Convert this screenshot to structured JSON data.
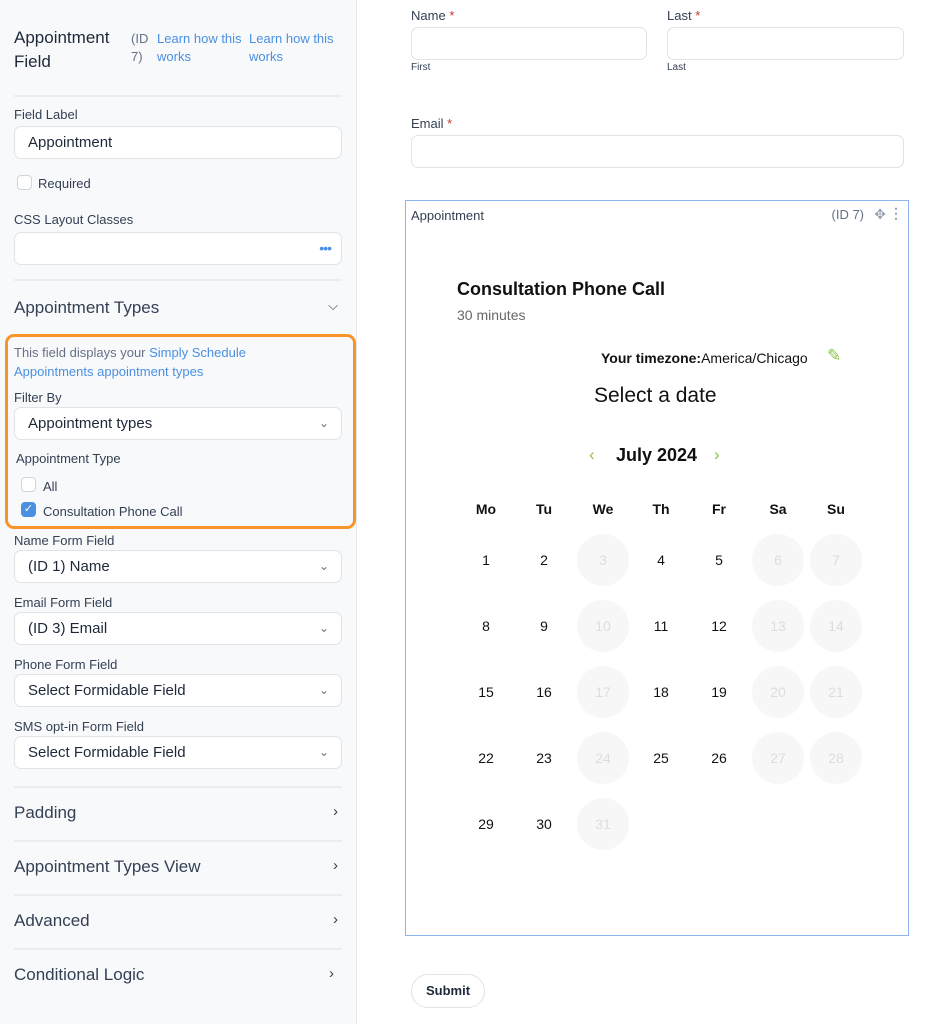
{
  "sidebar": {
    "title": "Appointment Field",
    "field_id": "(ID 7)",
    "learn_links": [
      "Learn how this works",
      "Learn how this works"
    ],
    "field_label": {
      "label": "Field Label",
      "value": "Appointment"
    },
    "required": {
      "label": "Required",
      "checked": false
    },
    "css_classes": {
      "label": "CSS Layout Classes",
      "value": "",
      "more_icon": "ellipsis-icon"
    },
    "appointment_types": {
      "heading": "Appointment Types",
      "expanded": true,
      "intro_text": "This field displays your ",
      "intro_link": "Simply Schedule Appointments appointment types",
      "filter_by": {
        "label": "Filter By",
        "value": "Appointment types"
      },
      "type_label": "Appointment Type",
      "options": [
        {
          "label": "All",
          "checked": false
        },
        {
          "label": "Consultation Phone Call",
          "checked": true
        }
      ]
    },
    "mappings": [
      {
        "label": "Name Form Field",
        "value": "(ID 1) Name"
      },
      {
        "label": "Email Form Field",
        "value": "(ID 3) Email"
      },
      {
        "label": "Phone Form Field",
        "value": "Select Formidable Field"
      },
      {
        "label": "SMS opt-in Form Field",
        "value": "Select Formidable Field"
      }
    ],
    "sections": [
      "Padding",
      "Appointment Types View",
      "Advanced",
      "Conditional Logic"
    ]
  },
  "form": {
    "name": {
      "label": "Name",
      "sub_first": "First"
    },
    "last": {
      "label": "Last",
      "sub_last": "Last"
    },
    "email": {
      "label": "Email"
    },
    "required_marker": "*",
    "appointment": {
      "label": "Appointment",
      "id": "(ID 7)",
      "service_title": "Consultation Phone Call",
      "duration": "30 minutes",
      "timezone_label": "Your timezone:",
      "timezone_value": "America/Chicago",
      "select_date": "Select a date",
      "month": "July 2024",
      "weekdays": [
        "Mo",
        "Tu",
        "We",
        "Th",
        "Fr",
        "Sa",
        "Su"
      ],
      "days": [
        {
          "d": "1",
          "off": false
        },
        {
          "d": "2",
          "off": false
        },
        {
          "d": "3",
          "off": true
        },
        {
          "d": "4",
          "off": false
        },
        {
          "d": "5",
          "off": false
        },
        {
          "d": "6",
          "off": true
        },
        {
          "d": "7",
          "off": true
        },
        {
          "d": "8",
          "off": false
        },
        {
          "d": "9",
          "off": false
        },
        {
          "d": "10",
          "off": true
        },
        {
          "d": "11",
          "off": false
        },
        {
          "d": "12",
          "off": false
        },
        {
          "d": "13",
          "off": true
        },
        {
          "d": "14",
          "off": true
        },
        {
          "d": "15",
          "off": false
        },
        {
          "d": "16",
          "off": false
        },
        {
          "d": "17",
          "off": true
        },
        {
          "d": "18",
          "off": false
        },
        {
          "d": "19",
          "off": false
        },
        {
          "d": "20",
          "off": true
        },
        {
          "d": "21",
          "off": true
        },
        {
          "d": "22",
          "off": false
        },
        {
          "d": "23",
          "off": false
        },
        {
          "d": "24",
          "off": true
        },
        {
          "d": "25",
          "off": false
        },
        {
          "d": "26",
          "off": false
        },
        {
          "d": "27",
          "off": true
        },
        {
          "d": "28",
          "off": true
        },
        {
          "d": "29",
          "off": false
        },
        {
          "d": "30",
          "off": false
        },
        {
          "d": "31",
          "off": true
        }
      ]
    },
    "submit_label": "Submit"
  },
  "colors": {
    "accent": "#4a90e2",
    "highlight": "#f7952a",
    "calendar_green": "#8bc34a",
    "required": "#c0392b"
  }
}
